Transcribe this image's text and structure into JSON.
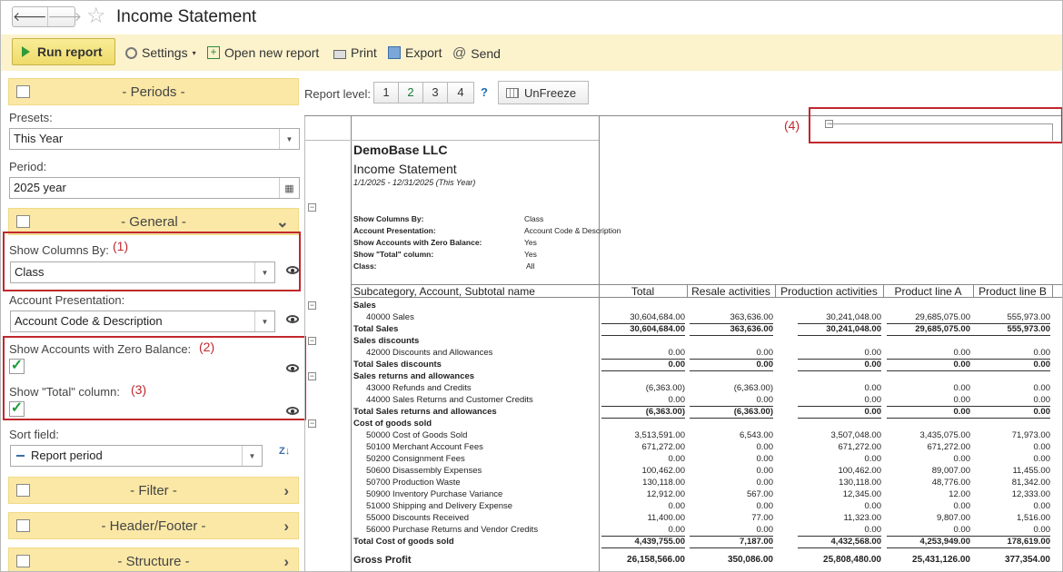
{
  "window": {
    "title": "Income Statement",
    "back": "🡐",
    "forward": "🡒"
  },
  "toolbar": {
    "run": "Run report",
    "settings": "Settings",
    "open_new": "Open new report",
    "print": "Print",
    "export": "Export",
    "send": "Send"
  },
  "left": {
    "periods": "- Periods -",
    "presets_label": "Presets:",
    "presets_value": "This Year",
    "period_label": "Period:",
    "period_value": "2025 year",
    "general": "- General -",
    "show_columns_label": "Show Columns By:",
    "show_columns_value": "Class",
    "account_pres_label": "Account Presentation:",
    "account_pres_value": "Account Code & Description",
    "zero_balance_label": "Show Accounts with Zero Balance:",
    "total_col_label": "Show \"Total\" column:",
    "sort_label": "Sort field:",
    "sort_value": "Report period",
    "filter": "- Filter -",
    "header_footer": "- Header/Footer -",
    "structure": "- Structure -",
    "ann1": "(1)",
    "ann2": "(2)",
    "ann3": "(3)",
    "sort_icon": "Z↓"
  },
  "main": {
    "report_level": "Report level:",
    "levels": [
      "1",
      "2",
      "3",
      "4"
    ],
    "help": "?",
    "unfreeze": "UnFreeze",
    "ann4": "(4)"
  },
  "report": {
    "company": "DemoBase LLC",
    "title": "Income Statement",
    "period": "1/1/2025 - 12/31/2025 (This Year)",
    "params": [
      [
        "Show Columns By:",
        "Class"
      ],
      [
        "Account Presentation:",
        "Account Code & Description"
      ],
      [
        "Show Accounts with Zero Balance:",
        "Yes"
      ],
      [
        "Show \"Total\" column:",
        "Yes"
      ],
      [
        "Class:",
        "All"
      ]
    ],
    "col_headers": [
      "Subcategory, Account, Subtotal name",
      "Total",
      "Resale activities",
      "Production activities",
      "Product line A",
      "Product line B"
    ],
    "rows": [
      {
        "t": "Sales",
        "type": "group",
        "v": []
      },
      {
        "t": "40000 Sales",
        "type": "acct",
        "v": [
          "30,604,684.00",
          "363,636.00",
          "30,241,048.00",
          "29,685,075.00",
          "555,973.00"
        ]
      },
      {
        "t": "Total Sales",
        "type": "total",
        "v": [
          "30,604,684.00",
          "363,636.00",
          "30,241,048.00",
          "29,685,075.00",
          "555,973.00"
        ]
      },
      {
        "t": "Sales discounts",
        "type": "group",
        "v": []
      },
      {
        "t": "42000 Discounts and Allowances",
        "type": "acct",
        "v": [
          "0.00",
          "0.00",
          "0.00",
          "0.00",
          "0.00"
        ]
      },
      {
        "t": "Total Sales discounts",
        "type": "total",
        "v": [
          "0.00",
          "0.00",
          "0.00",
          "0.00",
          "0.00"
        ]
      },
      {
        "t": "Sales returns and allowances",
        "type": "group",
        "v": []
      },
      {
        "t": "43000 Refunds and Credits",
        "type": "acct",
        "v": [
          "(6,363.00)",
          "(6,363.00)",
          "0.00",
          "0.00",
          "0.00"
        ]
      },
      {
        "t": "44000 Sales Returns and Customer Credits",
        "type": "acct",
        "v": [
          "0.00",
          "0.00",
          "0.00",
          "0.00",
          "0.00"
        ]
      },
      {
        "t": "Total Sales returns and allowances",
        "type": "total",
        "v": [
          "(6,363.00)",
          "(6,363.00)",
          "0.00",
          "0.00",
          "0.00"
        ]
      },
      {
        "t": "Cost of goods sold",
        "type": "group",
        "v": []
      },
      {
        "t": "50000 Cost of Goods Sold",
        "type": "acct",
        "v": [
          "3,513,591.00",
          "6,543.00",
          "3,507,048.00",
          "3,435,075.00",
          "71,973.00"
        ]
      },
      {
        "t": "50100 Merchant Account Fees",
        "type": "acct",
        "v": [
          "671,272.00",
          "0.00",
          "671,272.00",
          "671,272.00",
          "0.00"
        ]
      },
      {
        "t": "50200 Consignment Fees",
        "type": "acct",
        "v": [
          "0.00",
          "0.00",
          "0.00",
          "0.00",
          "0.00"
        ]
      },
      {
        "t": "50600 Disassembly Expenses",
        "type": "acct",
        "v": [
          "100,462.00",
          "0.00",
          "100,462.00",
          "89,007.00",
          "11,455.00"
        ]
      },
      {
        "t": "50700 Production Waste",
        "type": "acct",
        "v": [
          "130,118.00",
          "0.00",
          "130,118.00",
          "48,776.00",
          "81,342.00"
        ]
      },
      {
        "t": "50900 Inventory Purchase Variance",
        "type": "acct",
        "v": [
          "12,912.00",
          "567.00",
          "12,345.00",
          "12.00",
          "12,333.00"
        ]
      },
      {
        "t": "51000 Shipping and Delivery Expense",
        "type": "acct",
        "v": [
          "0.00",
          "0.00",
          "0.00",
          "0.00",
          "0.00"
        ]
      },
      {
        "t": "55000 Discounts Received",
        "type": "acct",
        "v": [
          "11,400.00",
          "77.00",
          "11,323.00",
          "9,807.00",
          "1,516.00"
        ]
      },
      {
        "t": "56000 Purchase Returns and Vendor Credits",
        "type": "acct",
        "v": [
          "0.00",
          "0.00",
          "0.00",
          "0.00",
          "0.00"
        ]
      },
      {
        "t": "Total Cost of goods sold",
        "type": "total",
        "v": [
          "4,439,755.00",
          "7,187.00",
          "4,432,568.00",
          "4,253,949.00",
          "178,619.00"
        ]
      },
      {
        "t": "Gross Profit",
        "type": "gross",
        "v": [
          "26,158,566.00",
          "350,086.00",
          "25,808,480.00",
          "25,431,126.00",
          "377,354.00"
        ]
      }
    ]
  }
}
